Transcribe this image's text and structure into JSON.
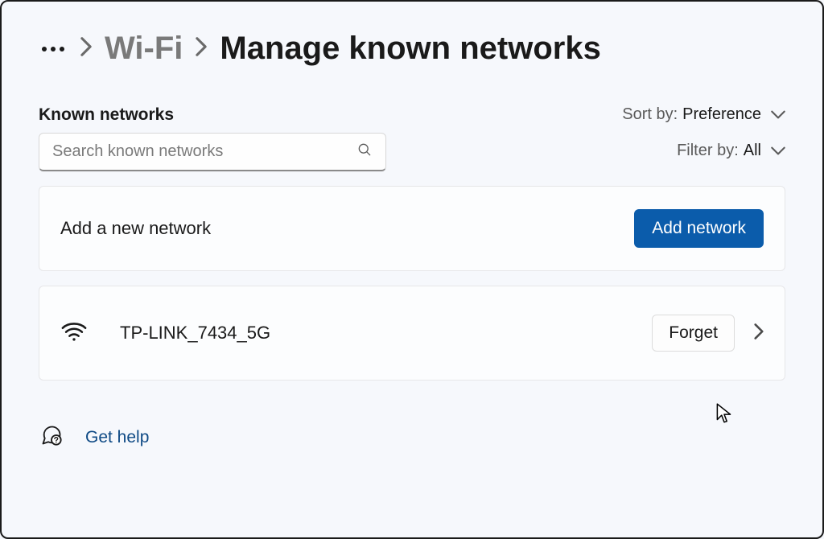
{
  "breadcrumb": {
    "parent": "Wi-Fi",
    "current": "Manage known networks"
  },
  "section": {
    "title": "Known networks",
    "search_placeholder": "Search known networks"
  },
  "sort": {
    "label": "Sort by:",
    "value": "Preference"
  },
  "filter": {
    "label": "Filter by:",
    "value": "All"
  },
  "add_card": {
    "label": "Add a new network",
    "button": "Add network"
  },
  "networks": [
    {
      "name": "TP-LINK_7434_5G",
      "forget_label": "Forget"
    }
  ],
  "help": {
    "label": "Get help"
  }
}
